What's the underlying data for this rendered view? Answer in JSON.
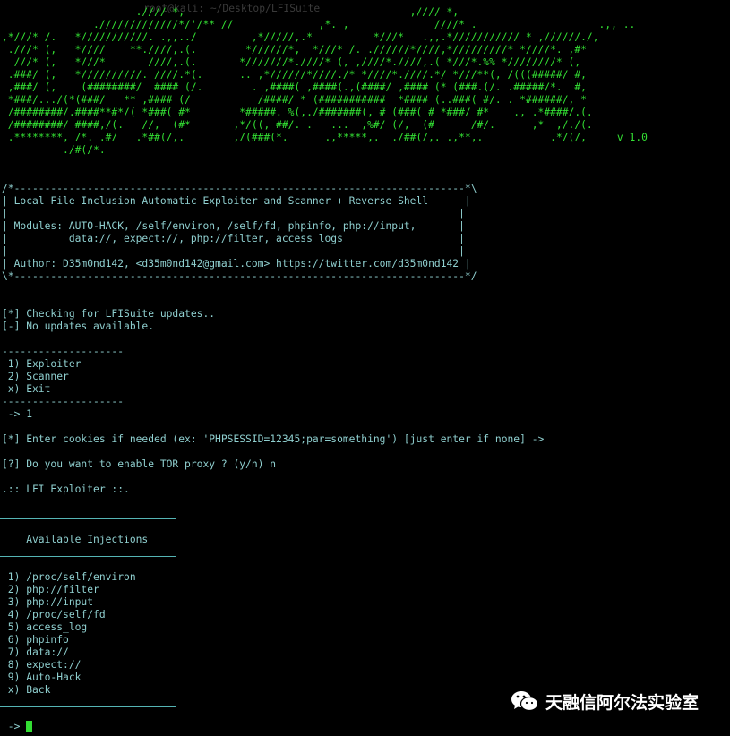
{
  "window": {
    "faint_path": "root@kali: ~/Desktop/LFISuite"
  },
  "banner": [
    "                      .//// *,                                     ,//// *,",
    "               ./////////////*/'/** //              ,*. ,              ////* .                    .,, ..",
    ",*///* /.   *///////////. .,,../         ,*/////,.*          *///*   .,,.*/////////// * ,//////./,",
    " .///* (,   *////    **.////,.(.        *//////*,  *///* /. .//////*////,*/////////* *////*. ,#*",
    "  ///* (,   *///*       ////,.(.       *///////*.////* (, ,////*.////,.( *///*.%% *////////* (,",
    " .###/ (,   *//////////. ////.*(.      .. ,*//////*////./* *////*.////.*/ *///**(, /(((#####/ #,",
    " ,###/ (,    (########/  #### (/.        . ,####( ,####(.,(####/ ,#### (* (###.(/. .#####/*.  #,",
    " *###/.../(*(###/   ** ,#### (/           /####/ * (###########  *#### (..###( #/. . *######/, *",
    " /########/.####**#*/( *###( #*        *#####. %(,./#######(, # (###( # *###/ #*    ., .*####/.(.",
    " /########/ ####,/(.   //,  (#*       ,*/((, ##/. .   ...  ,%#/ (/,  (#      /#/.      ,*  ,/./(.",
    " .********, /*. .#/   .*##(/,.        ,/(###(*.      .,*****,.  ./##(/,. .,**,.           .*/(/,     v 1.0",
    "          ./#(/*."
  ],
  "info_box": {
    "top_border": "/*--------------------------------------------------------------------------*\\",
    "title": "| Local File Inclusion Automatic Exploiter and Scanner + Reverse Shell      |",
    "blank": "|                                                                          |",
    "modules_1": "| Modules: AUTO-HACK, /self/environ, /self/fd, phpinfo, php://input,       |",
    "modules_2": "|          data://, expect://, php://filter, access logs                   |",
    "author": "| Author: D35m0nd142, <d35m0nd142@gmail.com> https://twitter.com/d35m0nd142 |",
    "bottom_border": "\\*--------------------------------------------------------------------------*/"
  },
  "updates": {
    "checking": "[*] Checking for LFISuite updates..",
    "none": "[-] No updates available."
  },
  "main_menu": {
    "separator": "--------------------",
    "items": [
      " 1) Exploiter",
      " 2) Scanner",
      " x) Exit"
    ],
    "prompt_answer": " -> 1"
  },
  "prompts": {
    "cookies": "[*] Enter cookies if needed (ex: 'PHPSESSID=12345;par=something') [just enter if none] ->",
    "tor": "[?] Do you want to enable TOR proxy ? (y/n) n"
  },
  "exploiter": {
    "title": ".:: LFI Exploiter ::.",
    "section_title": "    Available Injections",
    "injections": [
      " 1) /proc/self/environ",
      " 2) php://filter",
      " 3) php://input",
      " 4) /proc/self/fd",
      " 5) access_log",
      " 6) phpinfo",
      " 7) data://",
      " 8) expect://",
      " 9) Auto-Hack",
      " x) Back"
    ],
    "prompt": " -> "
  },
  "watermark": {
    "text": "天融信阿尔法实验室",
    "icon": "wechat-icon"
  },
  "colors": {
    "background": "#000000",
    "text": "#8fcfcf",
    "banner_green": "#33e033",
    "cursor": "#33dd33",
    "separator": "#55b4b4"
  }
}
